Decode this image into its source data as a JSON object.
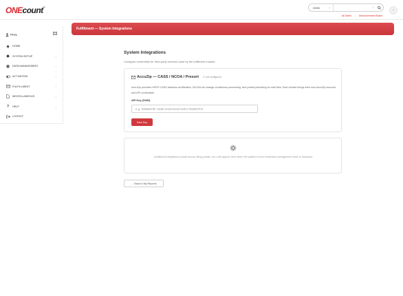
{
  "brand": {
    "one": "ONE",
    "count": "count",
    "tm": "®"
  },
  "header": {
    "search": {
      "scope": "GOID",
      "placeholder": "",
      "slash": "/"
    },
    "links": {
      "all_users": "All Users",
      "announcement": "Announcement Board"
    }
  },
  "sidebar": {
    "user": "PHIL",
    "items": [
      {
        "label": "HOME",
        "icon": "home-icon",
        "has_caret": false
      },
      {
        "label": "SYSTEM SETUP",
        "icon": "gear-icon",
        "has_caret": true
      },
      {
        "label": "DATA MANAGEMENT",
        "icon": "database-icon",
        "has_caret": true
      },
      {
        "label": "ACTIVATION",
        "icon": "toggle-icon",
        "has_caret": true
      },
      {
        "label": "FULFILLMENT",
        "icon": "card-icon",
        "has_caret": true
      },
      {
        "label": "MISCELLANEOUS",
        "icon": "file-icon",
        "has_caret": true
      },
      {
        "label": "HELP",
        "icon": "question-icon",
        "has_caret": true
      },
      {
        "label": "LOGOUT",
        "icon": "logout-icon",
        "has_caret": false
      }
    ]
  },
  "page": {
    "title": "Fulfillment — System Integrations",
    "section_title": "System Integrations",
    "section_desc": "Configure credentials for third-party services used by the fulfillment module."
  },
  "accuzip": {
    "title": "AccuZip — CASS / NCOA / Presort",
    "status": "✕ not configured",
    "description": "AccuZip provides USPS CASS address certification, NCOALink change-of-address processing, and postal presorting for mail files. Each tenant brings their own AccuZip account and API credentials.",
    "api_key_label": "API Key (GUID)",
    "api_key_placeholder": "e.g. 039DEF9F-1035-4A03-814D-84FC7D0D07F0",
    "save_label": "Save Key"
  },
  "additional": {
    "text": "Additional integrations (audit bureau filing portals, etc.) will appear here when the platform-level credential management table is deployed."
  },
  "back_label": "← Back to My Reports",
  "colors": {
    "accent": "#cf393e",
    "title_bar": "#d24347"
  }
}
